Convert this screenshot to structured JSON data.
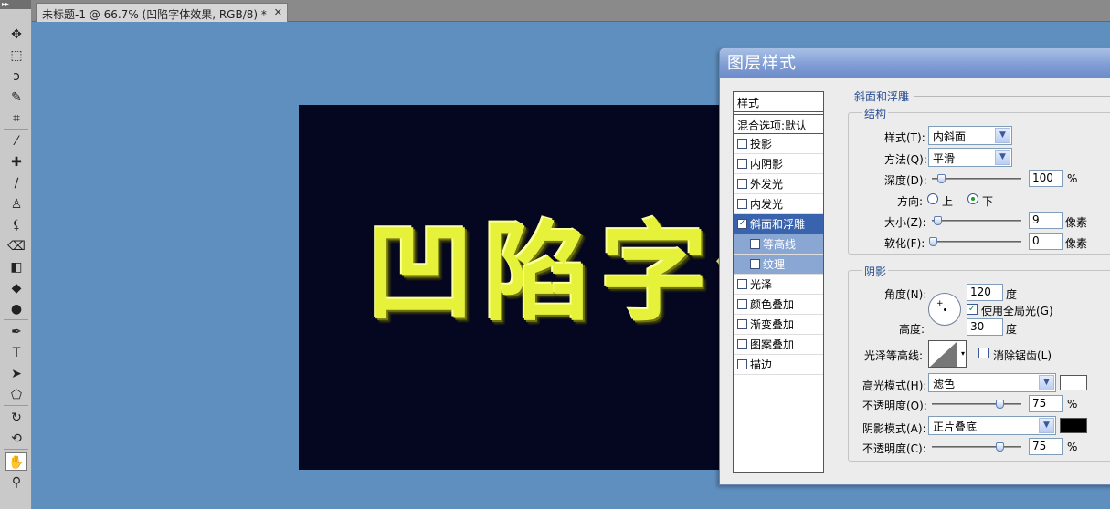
{
  "document": {
    "tab_title": "未标题-1 @ 66.7% (凹陷字体效果, RGB/8) *",
    "close_symbol": "✕",
    "canvas_text": "凹陷字体效果",
    "canvas_bg": "#050620",
    "text_color": "#e6f23a"
  },
  "toolbar": {
    "grip": "▸▸",
    "tools": [
      "move-icon",
      "marquee-icon",
      "lasso-icon",
      "magic-wand-icon",
      "crop-icon",
      "eyedropper-icon",
      "healing-brush-icon",
      "brush-icon",
      "clone-stamp-icon",
      "history-brush-icon",
      "eraser-icon",
      "paint-bucket-icon",
      "blur-icon",
      "dodge-icon",
      "pen-icon",
      "type-icon",
      "path-select-icon",
      "shape-icon",
      "rotate-3d-icon",
      "orbit-3d-icon",
      "hand-icon",
      "zoom-icon"
    ],
    "glyphs": [
      "✥",
      "⬚",
      "ↄ",
      "✎",
      "⌗",
      "⁄",
      "✚",
      "∕",
      "♙",
      "⚸",
      "⌫",
      "◧",
      "◆",
      "●",
      "✒",
      "T",
      "➤",
      "⬠",
      "↻",
      "⟲",
      "✋",
      "⚲"
    ],
    "active_index": 20
  },
  "dialog": {
    "title": "图层样式",
    "style_list": {
      "header": "样式",
      "blend_options": "混合选项:默认",
      "items": [
        {
          "label": "投影",
          "checked": false
        },
        {
          "label": "内阴影",
          "checked": false
        },
        {
          "label": "外发光",
          "checked": false
        },
        {
          "label": "内发光",
          "checked": false
        },
        {
          "label": "斜面和浮雕",
          "checked": true,
          "selected": true
        },
        {
          "label": "等高线",
          "checked": false,
          "sub": true
        },
        {
          "label": "纹理",
          "checked": false,
          "sub": true
        },
        {
          "label": "光泽",
          "checked": false
        },
        {
          "label": "颜色叠加",
          "checked": false
        },
        {
          "label": "渐变叠加",
          "checked": false
        },
        {
          "label": "图案叠加",
          "checked": false
        },
        {
          "label": "描边",
          "checked": false
        }
      ]
    },
    "bevel": {
      "section_title": "斜面和浮雕",
      "structure_title": "结构",
      "style_label": "样式(T):",
      "style_value": "内斜面",
      "technique_label": "方法(Q):",
      "technique_value": "平滑",
      "depth_label": "深度(D):",
      "depth_value": "100",
      "depth_unit": "%",
      "direction_label": "方向:",
      "dir_up": "上",
      "dir_down": "下",
      "size_label": "大小(Z):",
      "size_value": "9",
      "size_unit": "像素",
      "soften_label": "软化(F):",
      "soften_value": "0",
      "soften_unit": "像素"
    },
    "shading": {
      "title": "阴影",
      "angle_label": "角度(N):",
      "angle_value": "120",
      "angle_unit": "度",
      "global_light_label": "使用全局光(G)",
      "altitude_label": "高度:",
      "altitude_value": "30",
      "altitude_unit": "度",
      "gloss_label": "光泽等高线:",
      "antialias_label": "消除锯齿(L)",
      "highlight_label": "高光模式(H):",
      "highlight_value": "滤色",
      "highlight_color": "#ffffff",
      "highlight_opacity_label": "不透明度(O):",
      "highlight_opacity_value": "75",
      "shadow_label": "阴影模式(A):",
      "shadow_value": "正片叠底",
      "shadow_color": "#000000",
      "shadow_opacity_label": "不透明度(C):",
      "shadow_opacity_value": "75",
      "percent": "%"
    }
  }
}
